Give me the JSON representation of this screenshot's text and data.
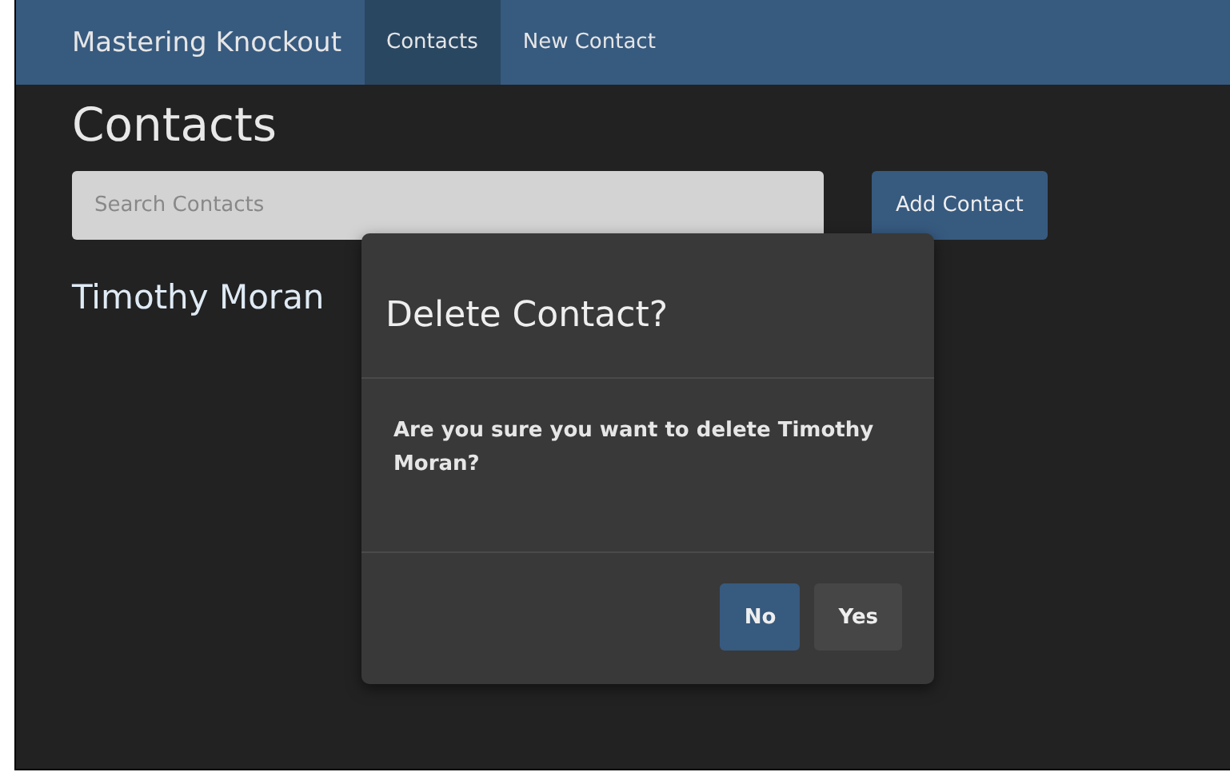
{
  "navbar": {
    "brand": "Mastering Knockout",
    "links": [
      {
        "label": "Contacts",
        "selected": true
      },
      {
        "label": "New Contact",
        "selected": false
      }
    ]
  },
  "page": {
    "title": "Contacts",
    "search": {
      "placeholder": "Search Contacts"
    },
    "add_button": "Add Contact",
    "contacts": [
      "Timothy Moran"
    ]
  },
  "dialog": {
    "title": "Delete Contact?",
    "message": "Are you sure you want to delete Timothy Moran?",
    "buttons": [
      {
        "label": "No",
        "kind": "primary"
      },
      {
        "label": "Yes",
        "kind": "default"
      }
    ]
  }
}
